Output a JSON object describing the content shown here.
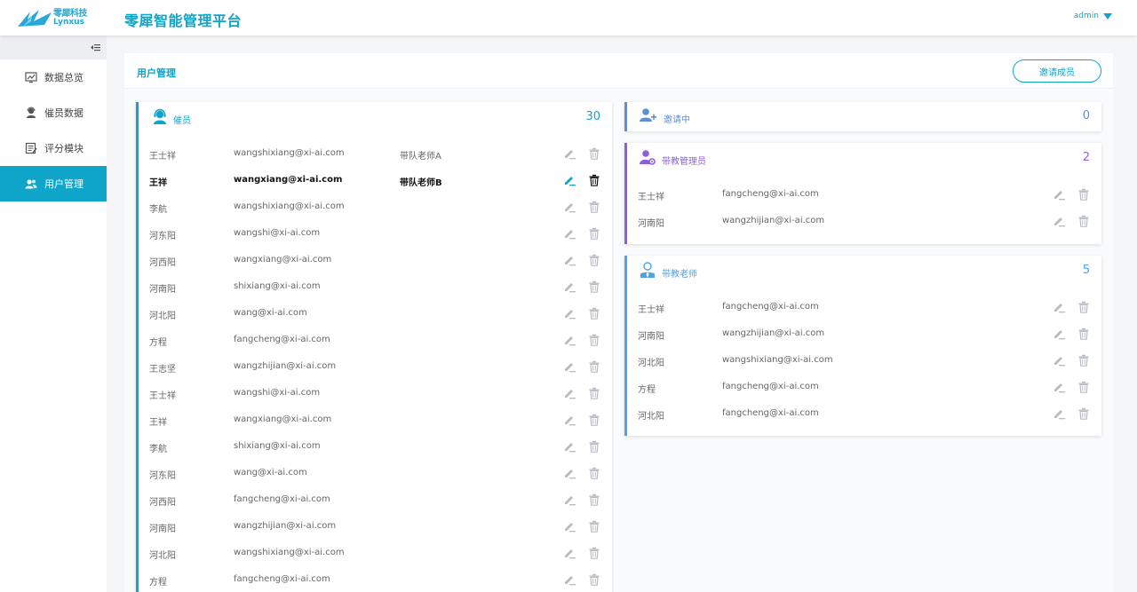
{
  "brand": {
    "logo_cn": "零犀科技",
    "logo_en": "Lynxus",
    "app_title": "零犀智能管理平台"
  },
  "user_menu": {
    "label": "admin"
  },
  "sidebar": {
    "collapse_icon": "collapse-icon",
    "items": [
      {
        "label": "数据总览",
        "icon": "chart-icon"
      },
      {
        "label": "催员数据",
        "icon": "agent-icon"
      },
      {
        "label": "评分模块",
        "icon": "score-icon"
      },
      {
        "label": "用户管理",
        "icon": "users-icon",
        "active": true
      }
    ]
  },
  "main": {
    "title": "用户管理",
    "invite_button": "邀请成员"
  },
  "collectors": {
    "title": "催员",
    "count": "30",
    "accent": "#0fa5c8",
    "rows": [
      {
        "name": "王士祥",
        "email": "wangshixiang@xi-ai.com",
        "teacher": "带队老师A"
      },
      {
        "name": "王祥",
        "email": "wangxiang@xi-ai.com",
        "teacher": "带队老师B",
        "highlight": true
      },
      {
        "name": "李航",
        "email": "wangshixiang@xi-ai.com",
        "teacher": ""
      },
      {
        "name": "河东阳",
        "email": "wangshi@xi-ai.com",
        "teacher": ""
      },
      {
        "name": "河西阳",
        "email": "wangxiang@xi-ai.com",
        "teacher": ""
      },
      {
        "name": "河南阳",
        "email": "shixiang@xi-ai.com",
        "teacher": ""
      },
      {
        "name": "河北阳",
        "email": "wang@xi-ai.com",
        "teacher": ""
      },
      {
        "name": "方程",
        "email": "fangcheng@xi-ai.com",
        "teacher": ""
      },
      {
        "name": "王志坚",
        "email": "wangzhijian@xi-ai.com",
        "teacher": ""
      },
      {
        "name": "王士祥",
        "email": "wangshi@xi-ai.com",
        "teacher": ""
      },
      {
        "name": "王祥",
        "email": "wangxiang@xi-ai.com",
        "teacher": ""
      },
      {
        "name": "李航",
        "email": "shixiang@xi-ai.com",
        "teacher": ""
      },
      {
        "name": "河东阳",
        "email": "wang@xi-ai.com",
        "teacher": ""
      },
      {
        "name": "河西阳",
        "email": "fangcheng@xi-ai.com",
        "teacher": ""
      },
      {
        "name": "河南阳",
        "email": "wangzhijian@xi-ai.com",
        "teacher": ""
      },
      {
        "name": "河北阳",
        "email": "wangshixiang@xi-ai.com",
        "teacher": ""
      },
      {
        "name": "方程",
        "email": "fangcheng@xi-ai.com",
        "teacher": ""
      }
    ]
  },
  "inviting": {
    "title": "邀请中",
    "count": "0",
    "accent": "#5b8fd8"
  },
  "managers": {
    "title": "带教管理员",
    "count": "2",
    "accent": "#8e5fd9",
    "rows": [
      {
        "name": "王士祥",
        "email": "fangcheng@xi-ai.com"
      },
      {
        "name": "河南阳",
        "email": "wangzhijian@xi-ai.com"
      }
    ]
  },
  "teachers": {
    "title": "带教老师",
    "count": "5",
    "accent": "#4fa3e3",
    "rows": [
      {
        "name": "王士祥",
        "email": "fangcheng@xi-ai.com"
      },
      {
        "name": "河南阳",
        "email": "wangzhijian@xi-ai.com"
      },
      {
        "name": "河北阳",
        "email": "wangshixiang@xi-ai.com"
      },
      {
        "name": "方程",
        "email": "fangcheng@xi-ai.com"
      },
      {
        "name": "河北阳",
        "email": "fangcheng@xi-ai.com"
      }
    ]
  }
}
